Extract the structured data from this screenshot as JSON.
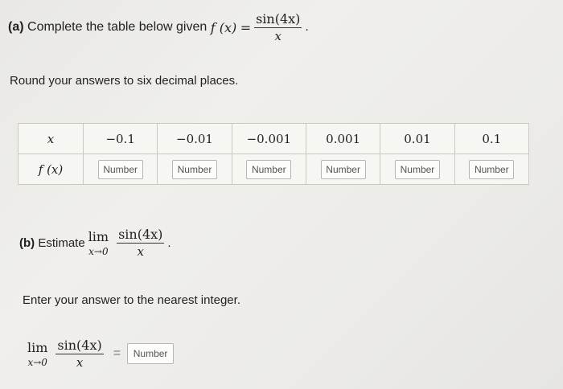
{
  "part_a": {
    "label": "(a)",
    "text": "Complete the table below given",
    "fx": "f (x)",
    "equals": "=",
    "numerator": "sin(4x)",
    "denominator": "x",
    "end": "."
  },
  "round_note": "Round your answers to six decimal places.",
  "table": {
    "row_x_label": "x",
    "row_fx_label": "f (x)",
    "x_values": [
      "−0.1",
      "−0.01",
      "−0.001",
      "0.001",
      "0.01",
      "0.1"
    ],
    "placeholder": "Number"
  },
  "part_b": {
    "label": "(b)",
    "text": "Estimate",
    "lim": "lim",
    "lim_sub": "x→0",
    "numerator": "sin(4x)",
    "denominator": "x",
    "end": "."
  },
  "nearest_note": "Enter your answer to the nearest integer.",
  "answer": {
    "lim": "lim",
    "lim_sub": "x→0",
    "numerator": "sin(4x)",
    "denominator": "x",
    "equals": "=",
    "placeholder": "Number"
  }
}
